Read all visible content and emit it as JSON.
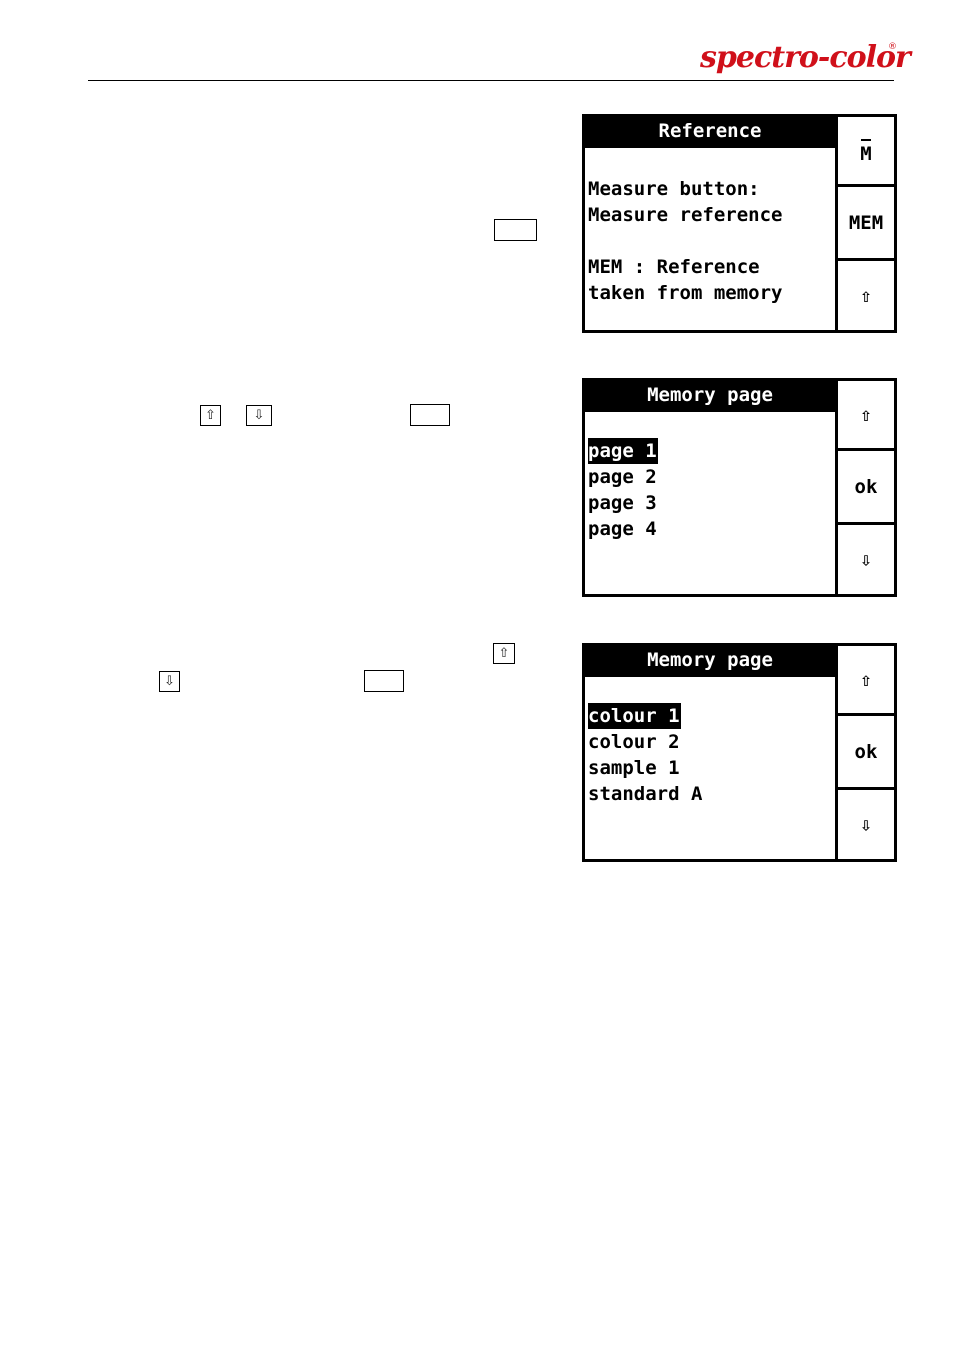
{
  "header": {
    "brand": "spectro-color",
    "registered_mark": "®"
  },
  "inline_keys": {
    "up_arrow": "⇧",
    "down_arrow": "⇩",
    "blank": ""
  },
  "screens": [
    {
      "title": "Reference",
      "lines": [
        "",
        "Measure button:",
        "Measure reference",
        "",
        "MEM : Reference",
        "taken from memory"
      ],
      "selected_index": null,
      "keys": [
        {
          "label": "M",
          "icon": "m-overbar-icon",
          "overbar": true
        },
        {
          "label": "MEM",
          "icon": null
        },
        {
          "label": "⇧",
          "icon": "up-arrow-icon"
        }
      ]
    },
    {
      "title": "Memory page",
      "lines": [
        "",
        "page 1",
        "page 2",
        "page 3",
        "page 4"
      ],
      "selected_index": 1,
      "keys": [
        {
          "label": "⇧",
          "icon": "up-arrow-icon"
        },
        {
          "label": "ok",
          "icon": null
        },
        {
          "label": "⇩",
          "icon": "down-arrow-icon"
        }
      ]
    },
    {
      "title": "Memory page",
      "lines": [
        "",
        "colour 1",
        "colour 2",
        "sample 1",
        "standard A"
      ],
      "selected_index": 1,
      "keys": [
        {
          "label": "⇧",
          "icon": "up-arrow-icon"
        },
        {
          "label": "ok",
          "icon": null
        },
        {
          "label": "⇩",
          "icon": "down-arrow-icon"
        }
      ]
    }
  ],
  "colors": {
    "brand_red": "#d0101a",
    "lcd_ink": "#000000",
    "paper": "#ffffff"
  }
}
